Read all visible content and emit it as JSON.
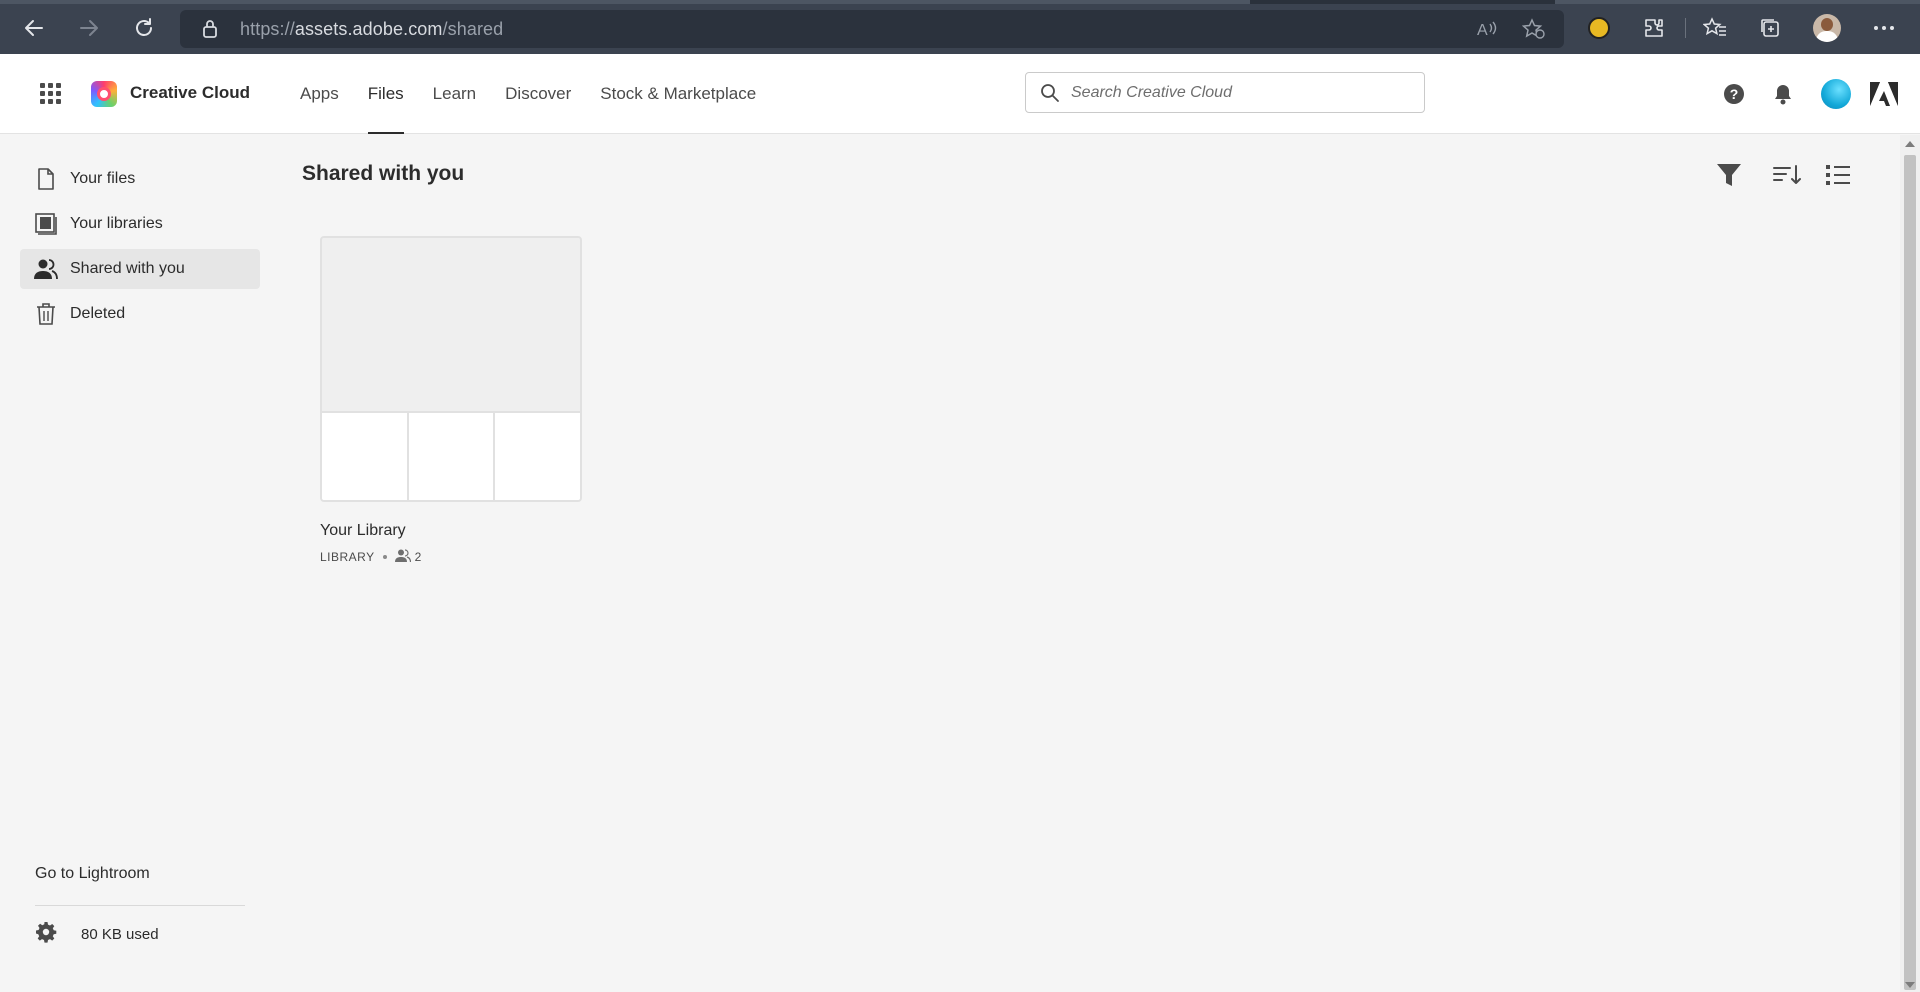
{
  "browser": {
    "url_prefix": "https://",
    "url_host": "assets.adobe.com",
    "url_path": "/shared"
  },
  "header": {
    "brand": "Creative Cloud",
    "nav": [
      {
        "label": "Apps"
      },
      {
        "label": "Files"
      },
      {
        "label": "Learn"
      },
      {
        "label": "Discover"
      },
      {
        "label": "Stock & Marketplace"
      }
    ],
    "active_nav": "Files",
    "search_placeholder": "Search Creative Cloud"
  },
  "sidebar": {
    "items": [
      {
        "label": "Your files",
        "icon": "file-icon"
      },
      {
        "label": "Your libraries",
        "icon": "library-icon"
      },
      {
        "label": "Shared with you",
        "icon": "shared-users-icon"
      },
      {
        "label": "Deleted",
        "icon": "trash-icon"
      }
    ],
    "active_item": "Shared with you",
    "lightroom_link": "Go to Lightroom",
    "storage_used": "80 KB used"
  },
  "main": {
    "title": "Shared with you",
    "toolbar": [
      "filter-icon",
      "sort-icon",
      "list-view-icon"
    ],
    "cards": [
      {
        "name": "Your Library",
        "type": "LIBRARY",
        "collaborators": "2"
      }
    ]
  },
  "colors": {
    "browser_bar": "#3b4350",
    "page_background": "#f5f5f5",
    "active_sidebar": "#e6e6e6",
    "profile_accent": "#12a8d8"
  }
}
